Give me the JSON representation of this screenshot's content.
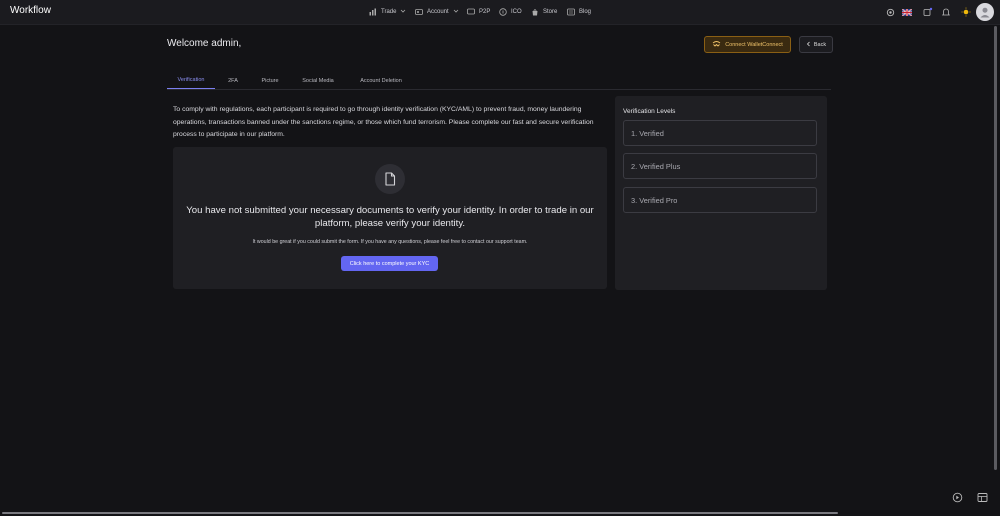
{
  "app": {
    "title": "Workflow"
  },
  "nav": {
    "items": [
      {
        "label": "Trade",
        "icon": "trade-icon",
        "dropdown": true
      },
      {
        "label": "Account",
        "icon": "account-icon",
        "dropdown": true
      },
      {
        "label": "P2P",
        "icon": "p2p-icon"
      },
      {
        "label": "ICO",
        "icon": "ico-icon"
      },
      {
        "label": "Store",
        "icon": "store-icon"
      },
      {
        "label": "Blog",
        "icon": "blog-icon"
      }
    ],
    "right_icons": [
      "settings-icon",
      "uk-flag-icon",
      "wallet-icon",
      "bell-icon",
      "theme-sun-icon",
      "user-avatar"
    ]
  },
  "header": {
    "welcome": "Welcome admin,",
    "connect_wallet": "Connect WalletConnect",
    "back": "Back"
  },
  "tabs": [
    "Verification",
    "2FA",
    "Picture",
    "Social Media",
    "Account Deletion"
  ],
  "active_tab": "Verification",
  "intro": "To comply with regulations, each participant is required to go through identity verification (KYC/AML) to prevent fraud, money laundering operations, transactions banned under the sanctions regime, or those which fund terrorism. Please complete our fast and secure verification process to participate in our platform.",
  "kyc": {
    "title": "You have not submitted your necessary documents to verify your identity. In order to trade in our platform, please verify your identity.",
    "subtitle": "It would be great if you could submit the form. If you have any questions, please feel free to contact our support team.",
    "button": "Click here to complete your KYC"
  },
  "levels": {
    "title": "Verification Levels",
    "items": [
      "1. Verified",
      "2. Verified Plus",
      "3. Verified Pro"
    ]
  },
  "colors": {
    "accent": "#6366f1",
    "wallet_button": "#8a5f14",
    "background": "#131316",
    "card": "#1f1f23"
  }
}
